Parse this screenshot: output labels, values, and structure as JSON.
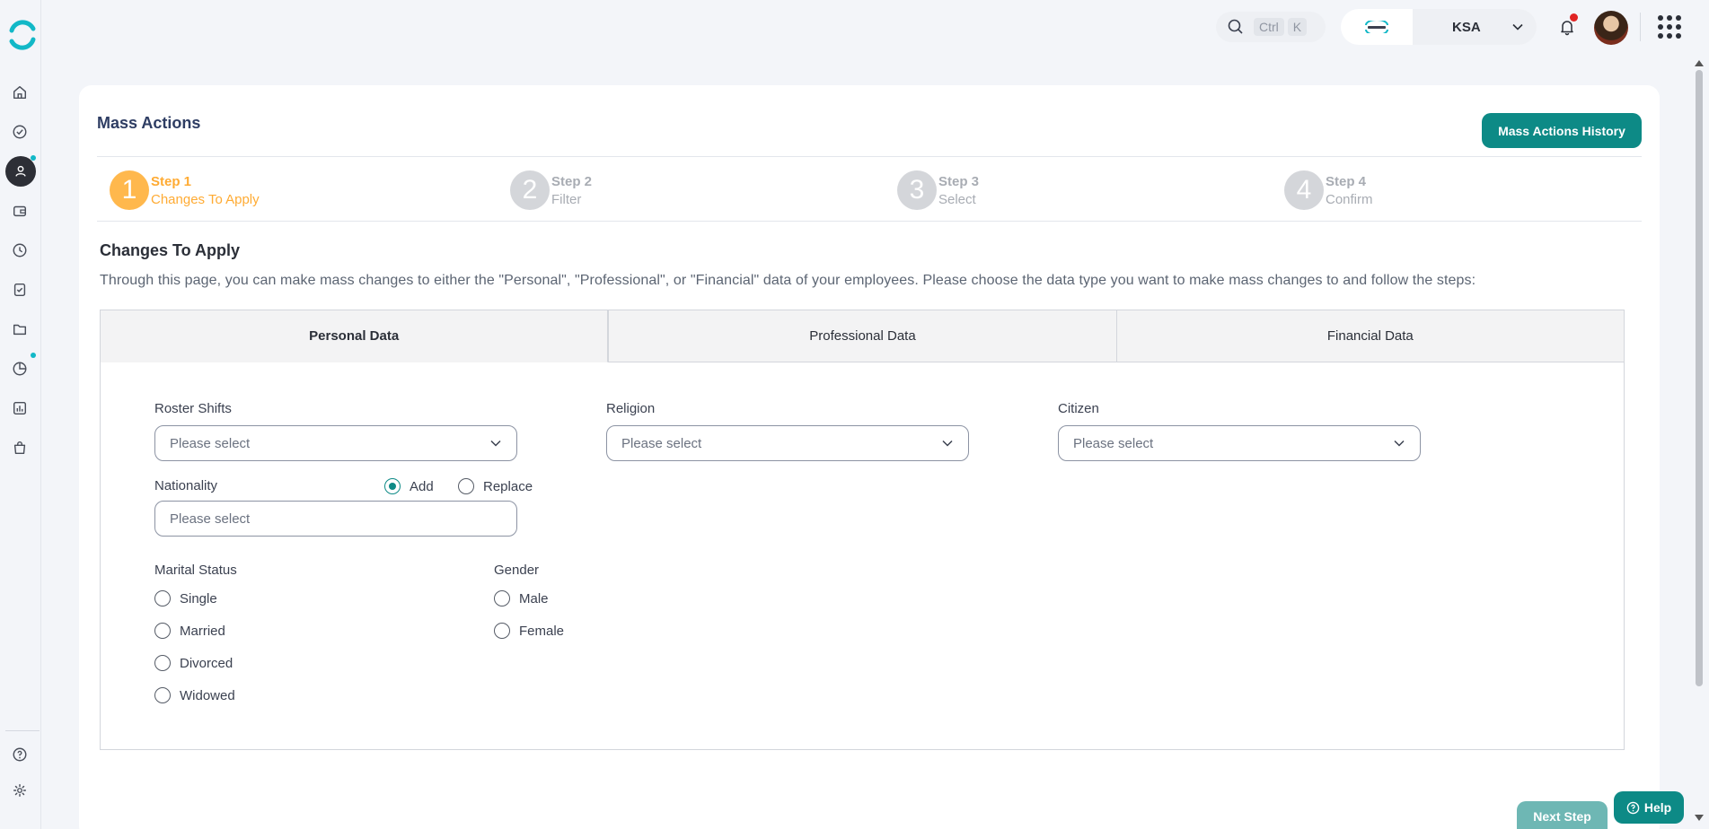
{
  "topbar": {
    "search_kbd_ctrl": "Ctrl",
    "search_kbd_k": "K",
    "company_name": "KSA"
  },
  "page": {
    "title": "Mass Actions",
    "history_button": "Mass Actions History"
  },
  "steps": [
    {
      "num": "1",
      "title": "Step 1",
      "label": "Changes To Apply"
    },
    {
      "num": "2",
      "title": "Step 2",
      "label": "Filter"
    },
    {
      "num": "3",
      "title": "Step 3",
      "label": "Select"
    },
    {
      "num": "4",
      "title": "Step 4",
      "label": "Confirm"
    }
  ],
  "section": {
    "title": "Changes To Apply",
    "description": "Through this page, you can make mass changes to either the \"Personal\", \"Professional\", or \"Financial\" data of your employees. Please choose the data type you want to make mass changes to and follow the steps:"
  },
  "tabs": [
    "Personal Data",
    "Professional Data",
    "Financial Data"
  ],
  "form": {
    "roster_shifts": {
      "label": "Roster Shifts",
      "placeholder": "Please select"
    },
    "religion": {
      "label": "Religion",
      "placeholder": "Please select"
    },
    "citizen": {
      "label": "Citizen",
      "placeholder": "Please select"
    },
    "nationality": {
      "label": "Nationality",
      "placeholder": "Please select",
      "add": "Add",
      "replace": "Replace",
      "mode": "Add"
    },
    "marital_status": {
      "label": "Marital Status",
      "options": [
        "Single",
        "Married",
        "Divorced",
        "Widowed"
      ]
    },
    "gender": {
      "label": "Gender",
      "options": [
        "Male",
        "Female"
      ]
    }
  },
  "footer": {
    "next_button": "Next Step",
    "help_button": "Help"
  },
  "colors": {
    "accent": "#0d8a86",
    "step_active": "#ffb84d",
    "title": "#2e3d63"
  }
}
